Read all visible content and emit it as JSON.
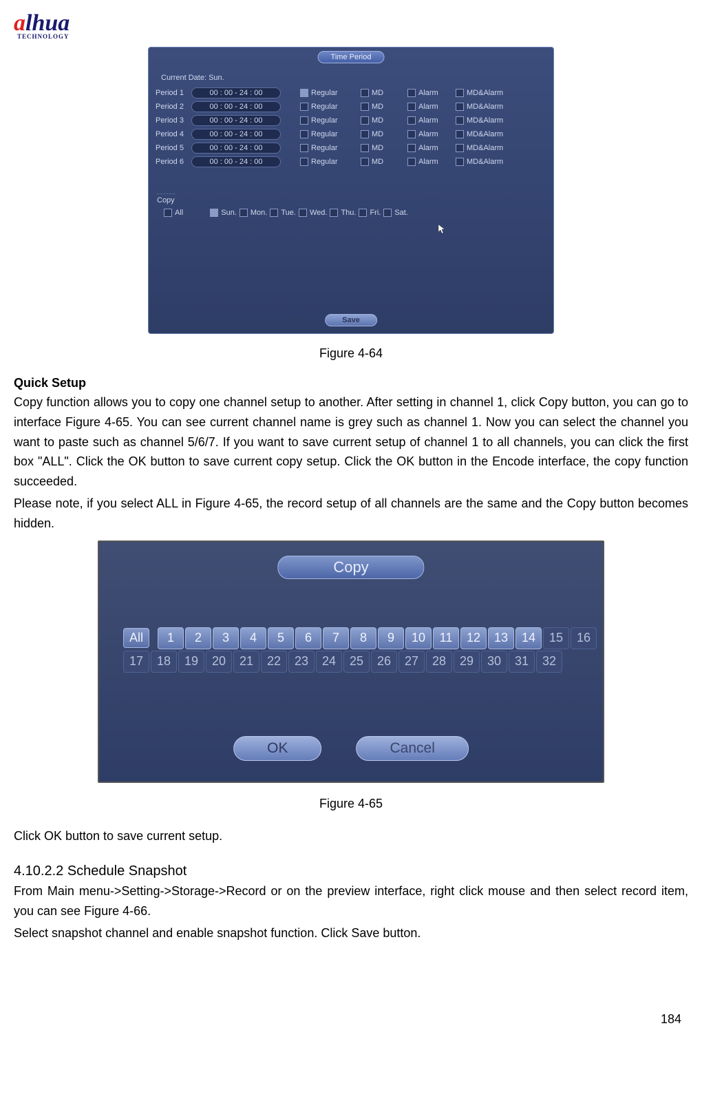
{
  "logo": {
    "brand_text_a": "a",
    "brand_text_rest": "lhua",
    "tagline": "TECHNOLOGY"
  },
  "time_period_panel": {
    "title": "Time Period",
    "current_date_label": "Current Date:  Sun.",
    "period_labels": [
      "Period 1",
      "Period 2",
      "Period 3",
      "Period 4",
      "Period 5",
      "Period 6"
    ],
    "time_value": "00 : 00    - 24 : 00",
    "cols": {
      "regular": "Regular",
      "md": "MD",
      "alarm": "Alarm",
      "mdalarm": "MD&Alarm"
    },
    "copy_label": "Copy",
    "all_label": "All",
    "days": [
      "Sun.",
      "Mon.",
      "Tue.",
      "Wed.",
      "Thu.",
      "Fri.",
      "Sat."
    ],
    "save": "Save"
  },
  "figure_1": "Figure 4-64",
  "quick_setup_heading": "Quick Setup",
  "paragraph_1": "Copy function allows you to copy one channel setup to another. After setting in channel 1, click Copy button, you can go to interface Figure 4-65. You can see current channel name is grey such as channel 1. Now you can select the channel you want to paste such as channel 5/6/7. If you want to save current setup of channel 1 to all channels, you can click the first box \"ALL\". Click the OK button to save current copy setup. Click the OK button in the Encode interface, the copy function succeeded.",
  "paragraph_2": "Please note, if you select ALL in Figure 4-65, the record setup of all channels are the same and the Copy button becomes hidden.",
  "copy_panel": {
    "title": "Copy",
    "all": "All",
    "channels_row1": [
      "1",
      "2",
      "3",
      "4",
      "5",
      "6",
      "7",
      "8",
      "9",
      "10",
      "11",
      "12",
      "13",
      "14",
      "15",
      "16"
    ],
    "channels_row2": [
      "17",
      "18",
      "19",
      "20",
      "21",
      "22",
      "23",
      "24",
      "25",
      "26",
      "27",
      "28",
      "29",
      "30",
      "31",
      "32"
    ],
    "ok": "OK",
    "cancel": "Cancel"
  },
  "figure_2": "Figure 4-65",
  "paragraph_3": "Click OK button to save current setup.",
  "section_heading": "4.10.2.2   Schedule Snapshot",
  "paragraph_4": "From Main menu->Setting->Storage->Record or on the preview interface, right click mouse and then select record item, you can see Figure 4-66.",
  "paragraph_5": "Select snapshot channel and enable snapshot function. Click Save button.",
  "page_number": "184"
}
